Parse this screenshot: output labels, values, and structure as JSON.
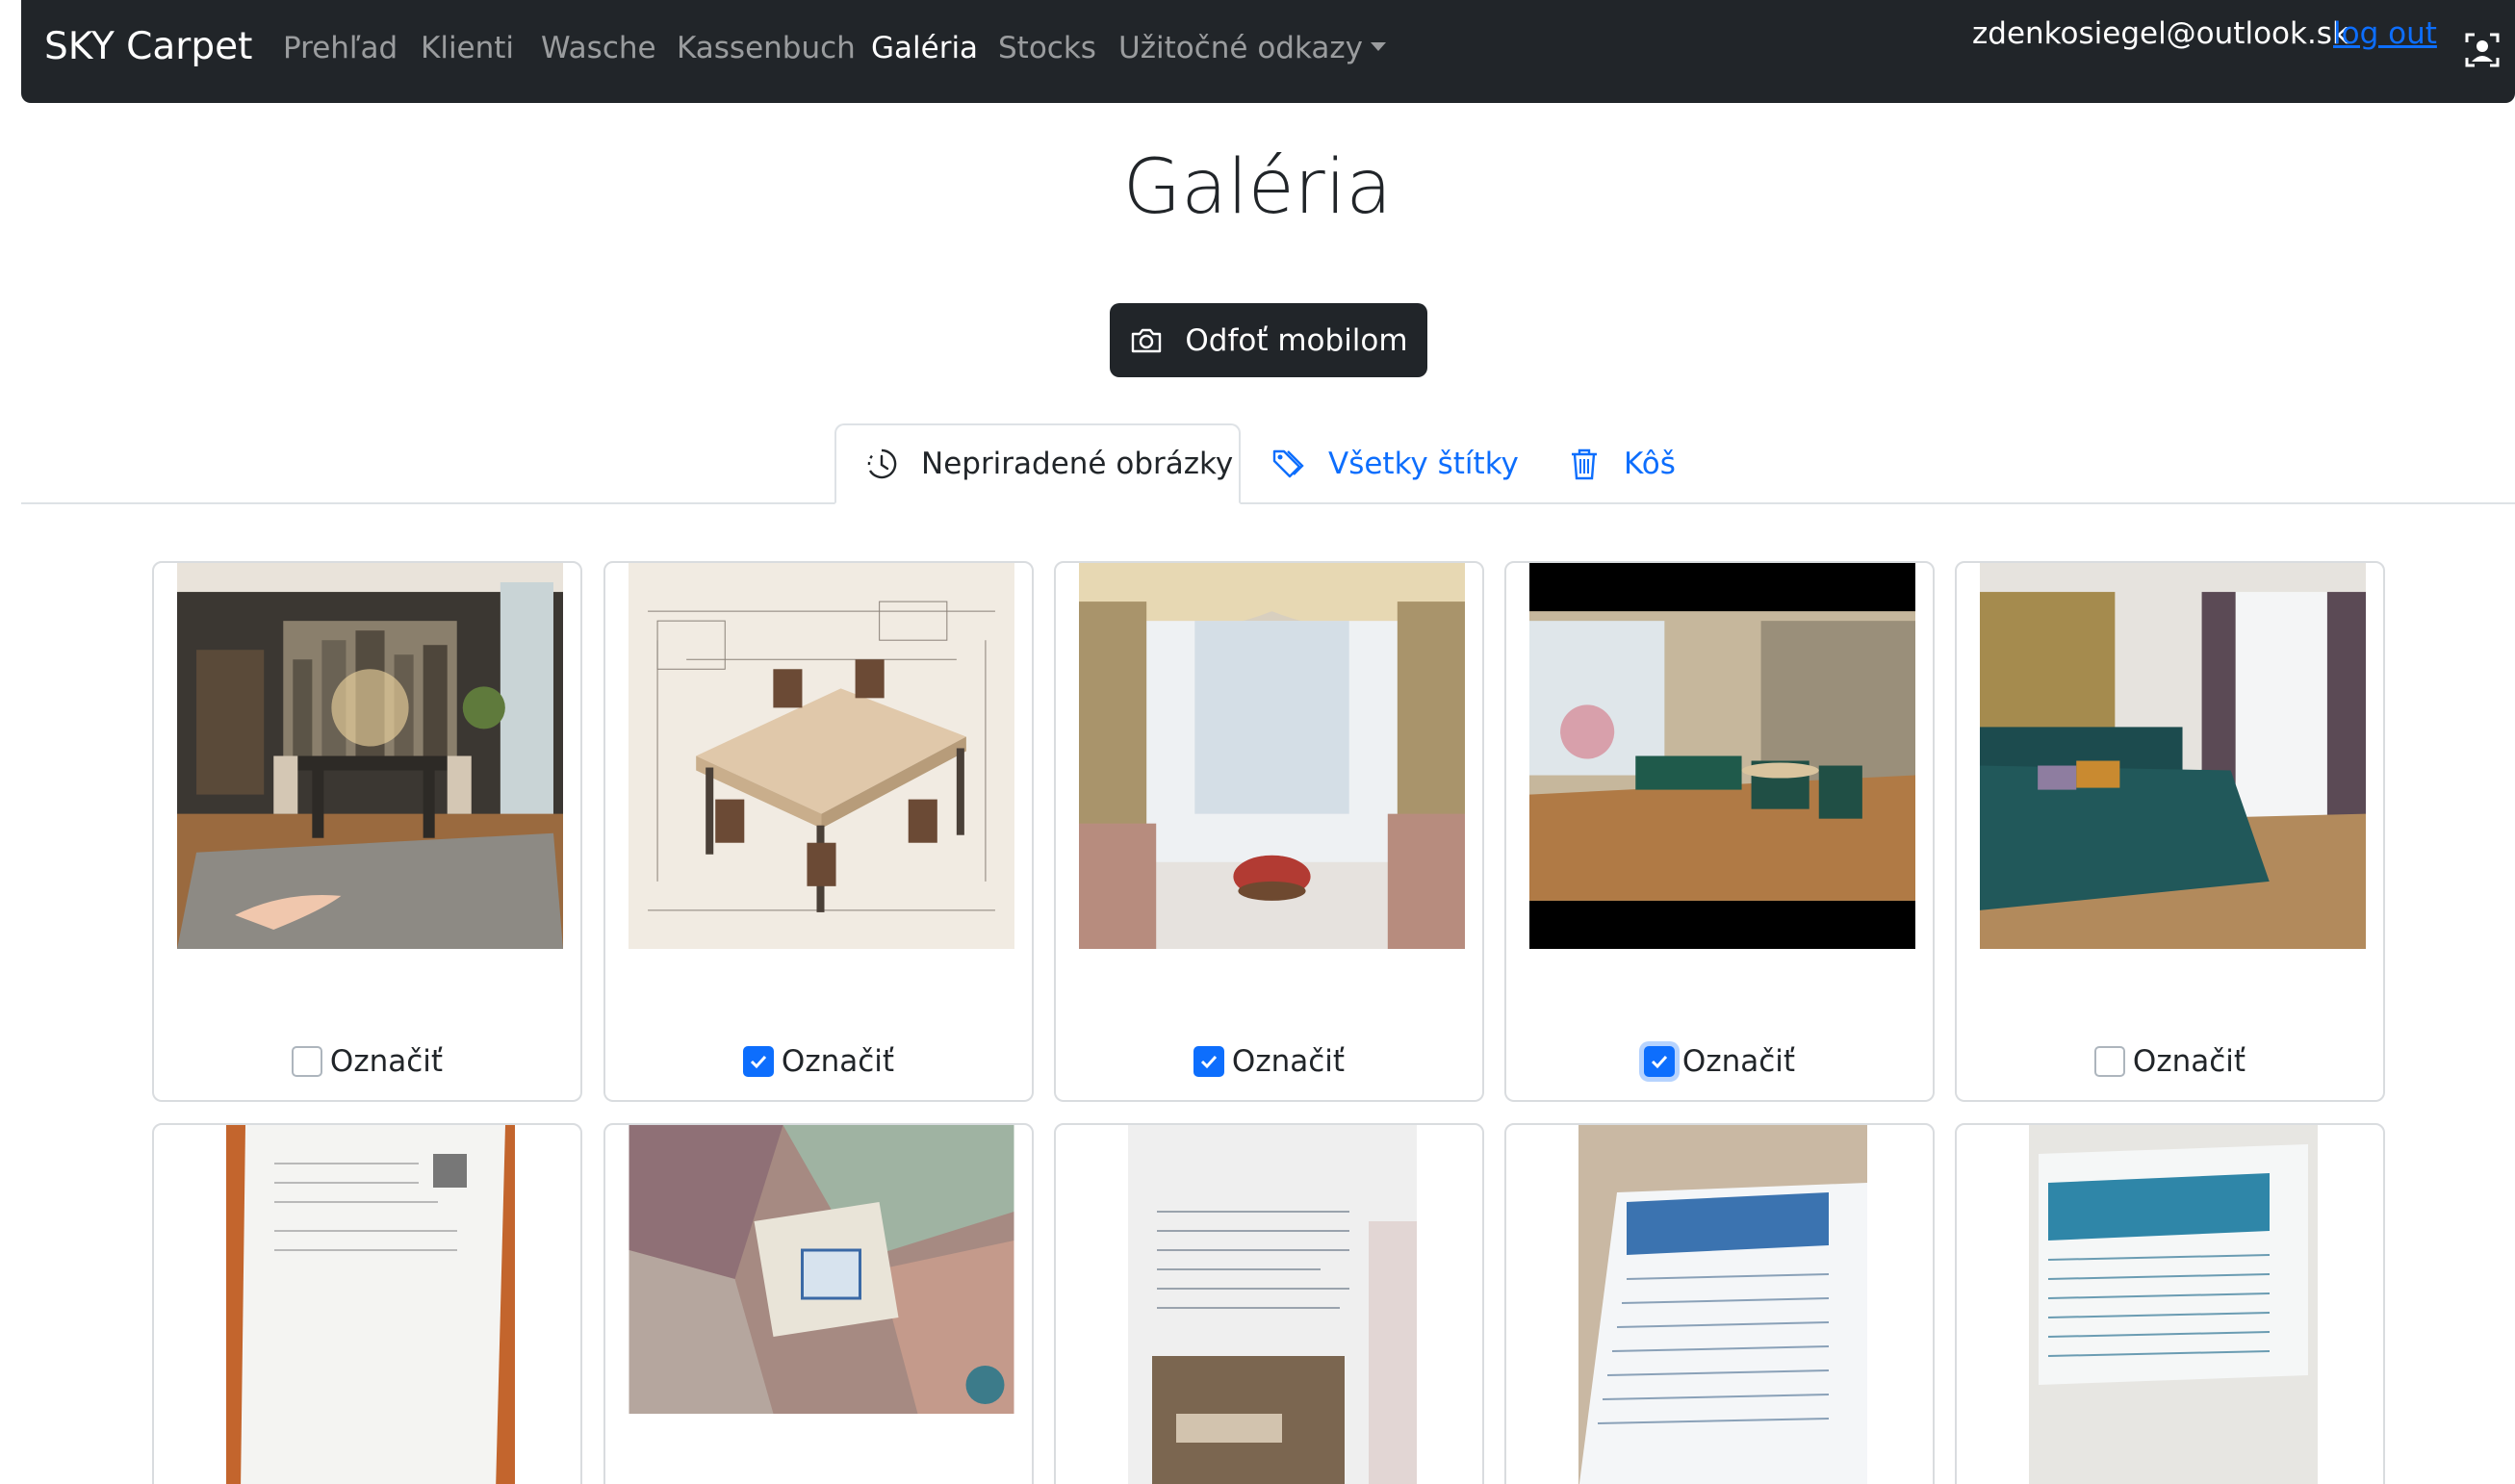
{
  "navbar": {
    "brand": "SKY Carpet",
    "links": [
      "Prehľad",
      "Klienti",
      "Wasche",
      "Kassenbuch",
      "Galéria",
      "Stocks",
      "Užitočné odkazy"
    ],
    "active": "Galéria",
    "user_email": "zdenkosiegel@outlook.sk",
    "logout": "log out"
  },
  "page": {
    "title": "Galéria",
    "camera_button": "Odfoť mobilom"
  },
  "tabs": {
    "unassigned": "Nepriradené obrázky",
    "all_tags": "Všetky štítky",
    "trash": "Kôš"
  },
  "gallery": {
    "check_label": "Označiť",
    "row1": [
      {
        "checked": false
      },
      {
        "checked": true
      },
      {
        "checked": true
      },
      {
        "checked": true
      },
      {
        "checked": false
      }
    ]
  },
  "colors": {
    "navbar_bg": "#212529",
    "link": "#0d6efd",
    "checkbox_checked": "#0d6efd"
  }
}
